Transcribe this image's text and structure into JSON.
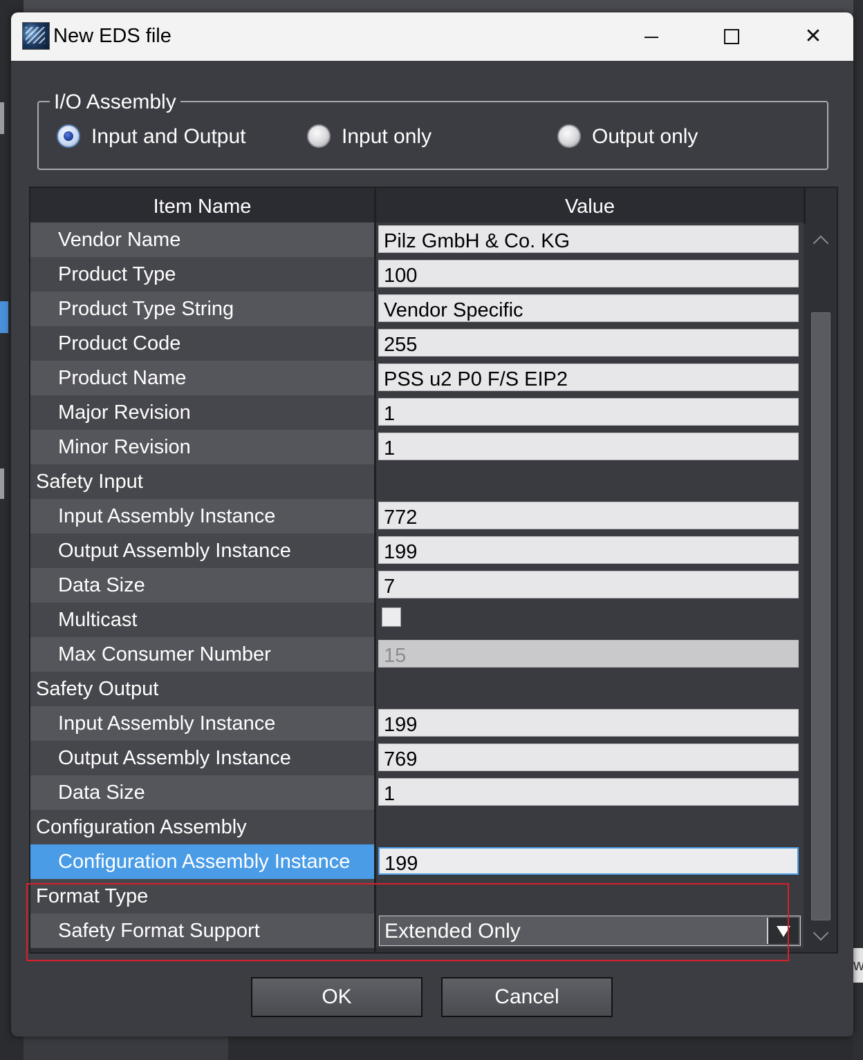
{
  "window": {
    "title": "New EDS file"
  },
  "io_assembly": {
    "legend": "I/O Assembly",
    "options": [
      {
        "label": "Input and Output",
        "checked": true
      },
      {
        "label": "Input only",
        "checked": false
      },
      {
        "label": "Output only",
        "checked": false
      }
    ]
  },
  "grid": {
    "header_name": "Item Name",
    "header_value": "Value",
    "rows": [
      {
        "name": "Vendor Name",
        "value": "Pilz GmbH & Co. KG",
        "kind": "text"
      },
      {
        "name": "Product Type",
        "value": "100",
        "kind": "text"
      },
      {
        "name": "Product Type String",
        "value": "Vendor Specific",
        "kind": "text"
      },
      {
        "name": "Product Code",
        "value": "255",
        "kind": "text"
      },
      {
        "name": "Product Name",
        "value": "PSS u2 P0 F/S EIP2",
        "kind": "text"
      },
      {
        "name": "Major Revision",
        "value": "1",
        "kind": "text"
      },
      {
        "name": "Minor Revision",
        "value": "1",
        "kind": "text"
      },
      {
        "name": "Safety Input",
        "value": "",
        "kind": "category"
      },
      {
        "name": "Input Assembly Instance",
        "value": "772",
        "kind": "text"
      },
      {
        "name": "Output Assembly Instance",
        "value": "199",
        "kind": "text"
      },
      {
        "name": "Data Size",
        "value": "7",
        "kind": "text"
      },
      {
        "name": "Multicast",
        "value": "",
        "kind": "checkbox"
      },
      {
        "name": "Max Consumer Number",
        "value": "15",
        "kind": "disabled"
      },
      {
        "name": "Safety Output",
        "value": "",
        "kind": "category"
      },
      {
        "name": "Input Assembly Instance",
        "value": "199",
        "kind": "text"
      },
      {
        "name": "Output Assembly Instance",
        "value": "769",
        "kind": "text"
      },
      {
        "name": "Data Size",
        "value": "1",
        "kind": "text"
      },
      {
        "name": "Configuration Assembly",
        "value": "",
        "kind": "category"
      },
      {
        "name": "Configuration Assembly Instance",
        "value": "199",
        "kind": "selected"
      },
      {
        "name": "Format Type",
        "value": "",
        "kind": "category"
      },
      {
        "name": "Safety Format Support",
        "value": "Extended Only",
        "kind": "combo"
      }
    ]
  },
  "buttons": {
    "ok": "OK",
    "cancel": "Cancel"
  },
  "background": {
    "edge_letter": "w"
  },
  "colors": {
    "selection": "#4a9ce6",
    "highlight": "#d9202a"
  }
}
